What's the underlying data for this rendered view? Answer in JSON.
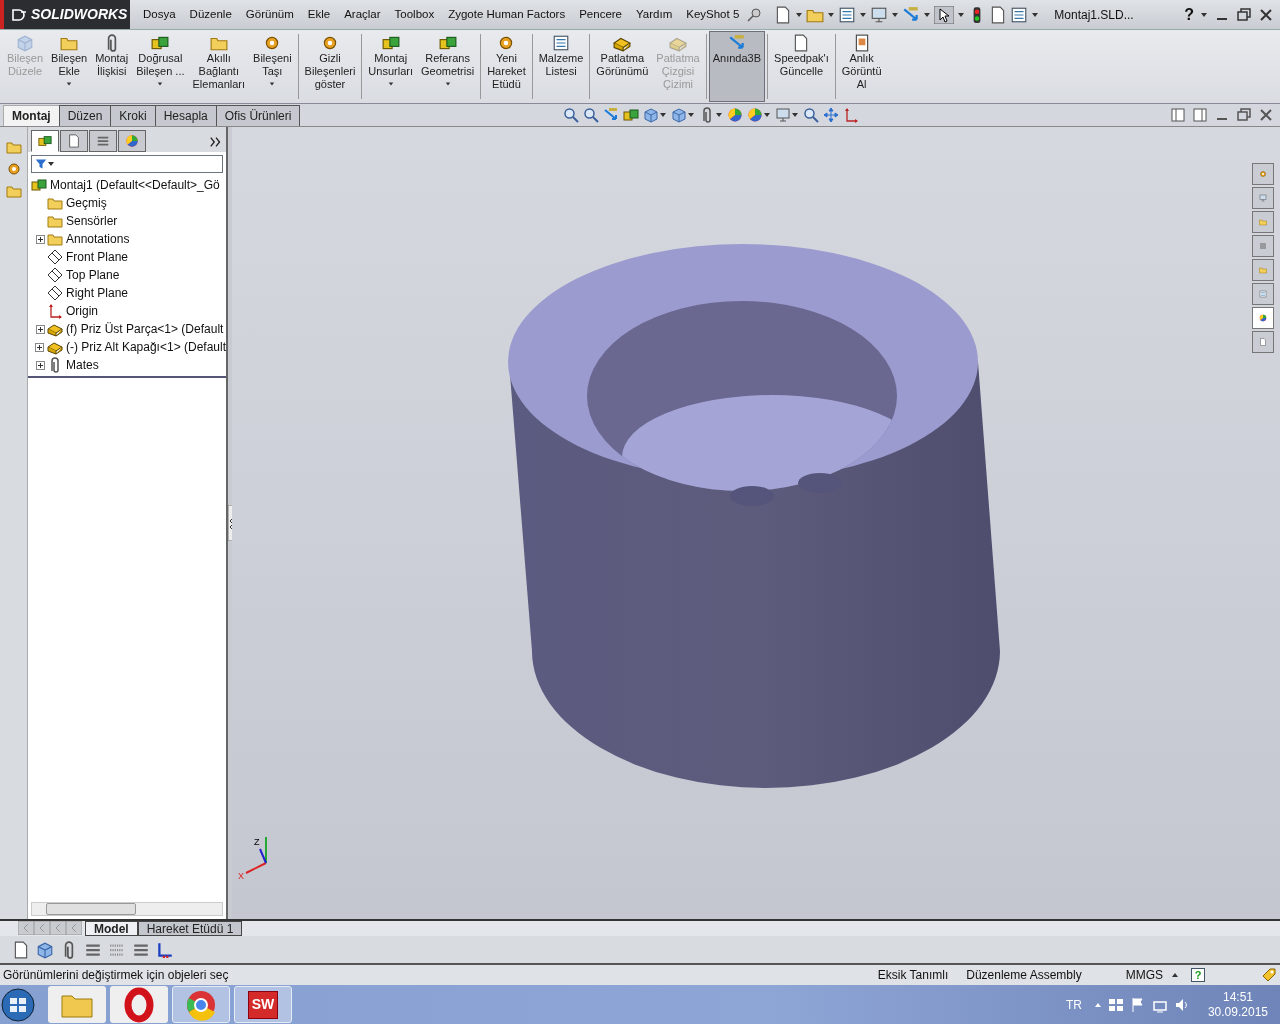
{
  "app": {
    "logo": "SOLIDWORKS",
    "menu": [
      "Dosya",
      "Düzenle",
      "Görünüm",
      "Ekle",
      "Araçlar",
      "Toolbox",
      "Zygote Human Factors",
      "Pencere",
      "Yardım",
      "KeyShot 5"
    ],
    "document_title": "Montaj1.SLD...",
    "help_label": "?"
  },
  "ribbon": {
    "groups": [
      [
        {
          "label": "Bileşen\nDüzele",
          "disabled": true,
          "dropdown": false,
          "selected": false
        },
        {
          "label": "Bileşen\nEkle",
          "disabled": false,
          "dropdown": true,
          "selected": false
        },
        {
          "label": "Montaj\nİlişkisi",
          "disabled": false,
          "dropdown": false,
          "selected": false
        },
        {
          "label": "Doğrusal\nBileşen ...",
          "disabled": false,
          "dropdown": true,
          "selected": false
        },
        {
          "label": "Akıllı\nBağlantı\nElemanları",
          "disabled": false,
          "dropdown": false,
          "selected": false
        },
        {
          "label": "Bileşeni\nTaşı",
          "disabled": false,
          "dropdown": true,
          "selected": false
        }
      ],
      [
        {
          "label": "Gizli\nBileşenleri\ngöster",
          "disabled": false,
          "dropdown": false,
          "selected": false
        }
      ],
      [
        {
          "label": "Montaj\nUnsurları",
          "disabled": false,
          "dropdown": true,
          "selected": false
        },
        {
          "label": "Referans\nGeometrisi",
          "disabled": false,
          "dropdown": true,
          "selected": false
        }
      ],
      [
        {
          "label": "Yeni\nHareket\nEtüdü",
          "disabled": false,
          "dropdown": false,
          "selected": false
        }
      ],
      [
        {
          "label": "Malzeme\nListesi",
          "disabled": false,
          "dropdown": false,
          "selected": false
        }
      ],
      [
        {
          "label": "Patlatma\nGörünümü",
          "disabled": false,
          "dropdown": false,
          "selected": false
        },
        {
          "label": "Patlatma\nÇizgisi\nÇizimi",
          "disabled": true,
          "dropdown": false,
          "selected": false
        }
      ],
      [
        {
          "label": "Anında3B",
          "disabled": false,
          "dropdown": false,
          "selected": true
        }
      ],
      [
        {
          "label": "Speedpak'ı\nGüncelle",
          "disabled": false,
          "dropdown": false,
          "selected": false
        }
      ],
      [
        {
          "label": "Anlık\nGörüntü\nAl",
          "disabled": false,
          "dropdown": false,
          "selected": false
        }
      ]
    ]
  },
  "ribbon_tabs": [
    {
      "label": "Montaj",
      "selected": true
    },
    {
      "label": "Düzen",
      "selected": false
    },
    {
      "label": "Kroki",
      "selected": false
    },
    {
      "label": "Hesapla",
      "selected": false
    },
    {
      "label": "Ofis Ürünleri",
      "selected": false
    }
  ],
  "feature_tree": {
    "panel_tabs": [
      {
        "selected": true
      },
      {
        "selected": false
      },
      {
        "selected": false
      },
      {
        "selected": false
      }
    ],
    "root": {
      "label": "Montaj1  (Default<<Default>_Gö",
      "kind": "assembly",
      "children": [
        {
          "label": "Geçmiş",
          "kind": "history",
          "collapsed": false
        },
        {
          "label": "Sensörler",
          "kind": "sensors",
          "collapsed": false
        },
        {
          "label": "Annotations",
          "kind": "annotations",
          "collapsed": true
        },
        {
          "label": "Front Plane",
          "kind": "plane",
          "collapsed": false
        },
        {
          "label": "Top Plane",
          "kind": "plane",
          "collapsed": false
        },
        {
          "label": "Right Plane",
          "kind": "plane",
          "collapsed": false
        },
        {
          "label": "Origin",
          "kind": "origin",
          "collapsed": false
        },
        {
          "label": "(f) Priz Üst Parça<1>  (Default",
          "kind": "part",
          "collapsed": true
        },
        {
          "label": "(-) Priz Alt Kapağı<1>  (Default",
          "kind": "part",
          "collapsed": true
        },
        {
          "label": "Mates",
          "kind": "mates",
          "collapsed": true
        }
      ]
    }
  },
  "triad": {
    "z": "Z",
    "x": "X"
  },
  "task_pane": [
    {
      "selected": false
    },
    {
      "selected": false
    },
    {
      "selected": false
    },
    {
      "selected": false
    },
    {
      "selected": false
    },
    {
      "selected": false
    },
    {
      "selected": true
    },
    {
      "selected": false
    }
  ],
  "bottom_tabs": [
    {
      "label": "Model",
      "selected": true
    },
    {
      "label": "Hareket Etüdü 1",
      "selected": false
    }
  ],
  "status_bar": {
    "message": "Görünümlerini değiştirmek için objeleri seç",
    "fields": [
      "Eksik Tanımlı",
      "Düzenleme Assembly",
      "MMGS"
    ],
    "help_label": "?"
  },
  "taskbar": {
    "apps": [
      {
        "kind": "explorer",
        "running": false
      },
      {
        "kind": "opera",
        "running": false
      },
      {
        "kind": "chrome",
        "running": true
      },
      {
        "kind": "solidworks",
        "running": true,
        "label": "SW"
      }
    ],
    "language": "TR",
    "time": "14:51",
    "date": "30.09.2015"
  }
}
